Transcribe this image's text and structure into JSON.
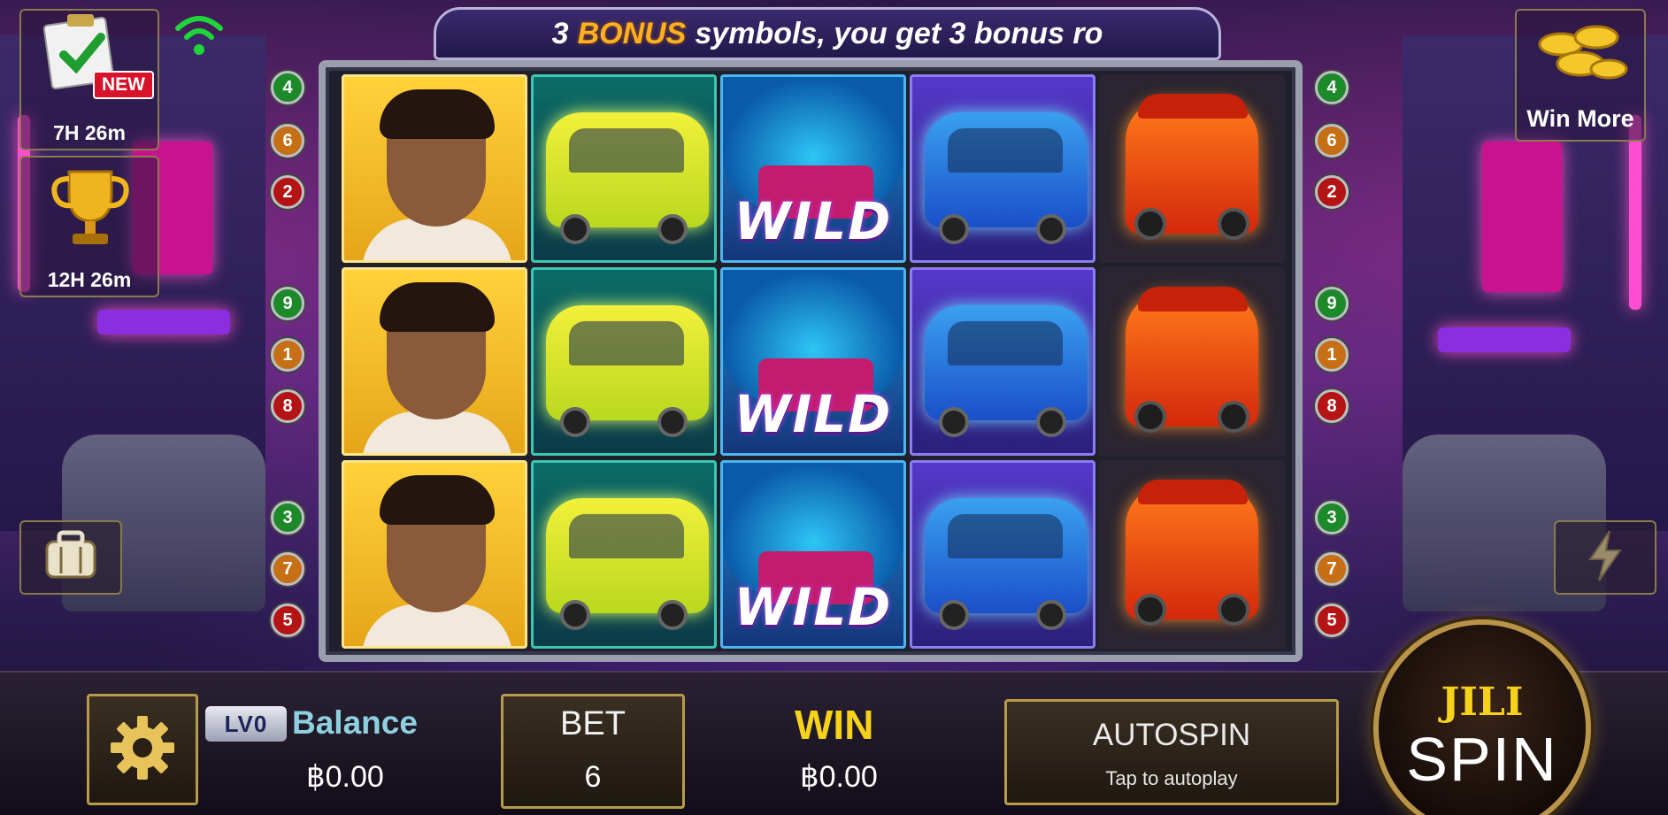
{
  "banner": {
    "prefix": "3",
    "highlight": "BONUS",
    "suffix": "symbols, you get 3 bonus ro"
  },
  "top_left": {
    "task_new_badge": "NEW",
    "task_timer": "7H 26m",
    "trophy_timer": "12H 26m"
  },
  "top_right": {
    "win_more_label": "Win More"
  },
  "reels": {
    "wild_label": "WILD",
    "columns": [
      [
        "man",
        "man",
        "man"
      ],
      [
        "yellow-taxi",
        "yellow-taxi",
        "yellow-taxi"
      ],
      [
        "wild",
        "wild",
        "wild"
      ],
      [
        "blue-taxi",
        "blue-taxi",
        "blue-taxi"
      ],
      [
        "tuk-tuk",
        "tuk-tuk",
        "tuk-tuk"
      ]
    ]
  },
  "paylines": {
    "left": [
      "4",
      "6",
      "2",
      "9",
      "1",
      "8",
      "3",
      "7",
      "5"
    ],
    "right": [
      "4",
      "6",
      "2",
      "9",
      "1",
      "8",
      "3",
      "7",
      "5"
    ],
    "colors": {
      "green": "#1d8a2a",
      "orange": "#c76f14",
      "red": "#b51414"
    }
  },
  "bottom": {
    "level_badge": "LV0",
    "balance_label": "Balance",
    "balance_value": "฿0.00",
    "bet_label": "BET",
    "bet_value": "6",
    "win_label": "WIN",
    "win_value": "฿0.00",
    "autospin_label": "AUTOSPIN",
    "autospin_sub": "Tap to autoplay",
    "spin_brand": "JILI",
    "spin_label": "SPIN"
  },
  "icons": {
    "task": "clipboard-check-icon",
    "wifi": "wifi-icon",
    "trophy": "trophy-icon",
    "coins": "gold-coins-icon",
    "bag": "backpack-icon",
    "bolt": "lightning-icon",
    "settings": "gear-icon"
  }
}
